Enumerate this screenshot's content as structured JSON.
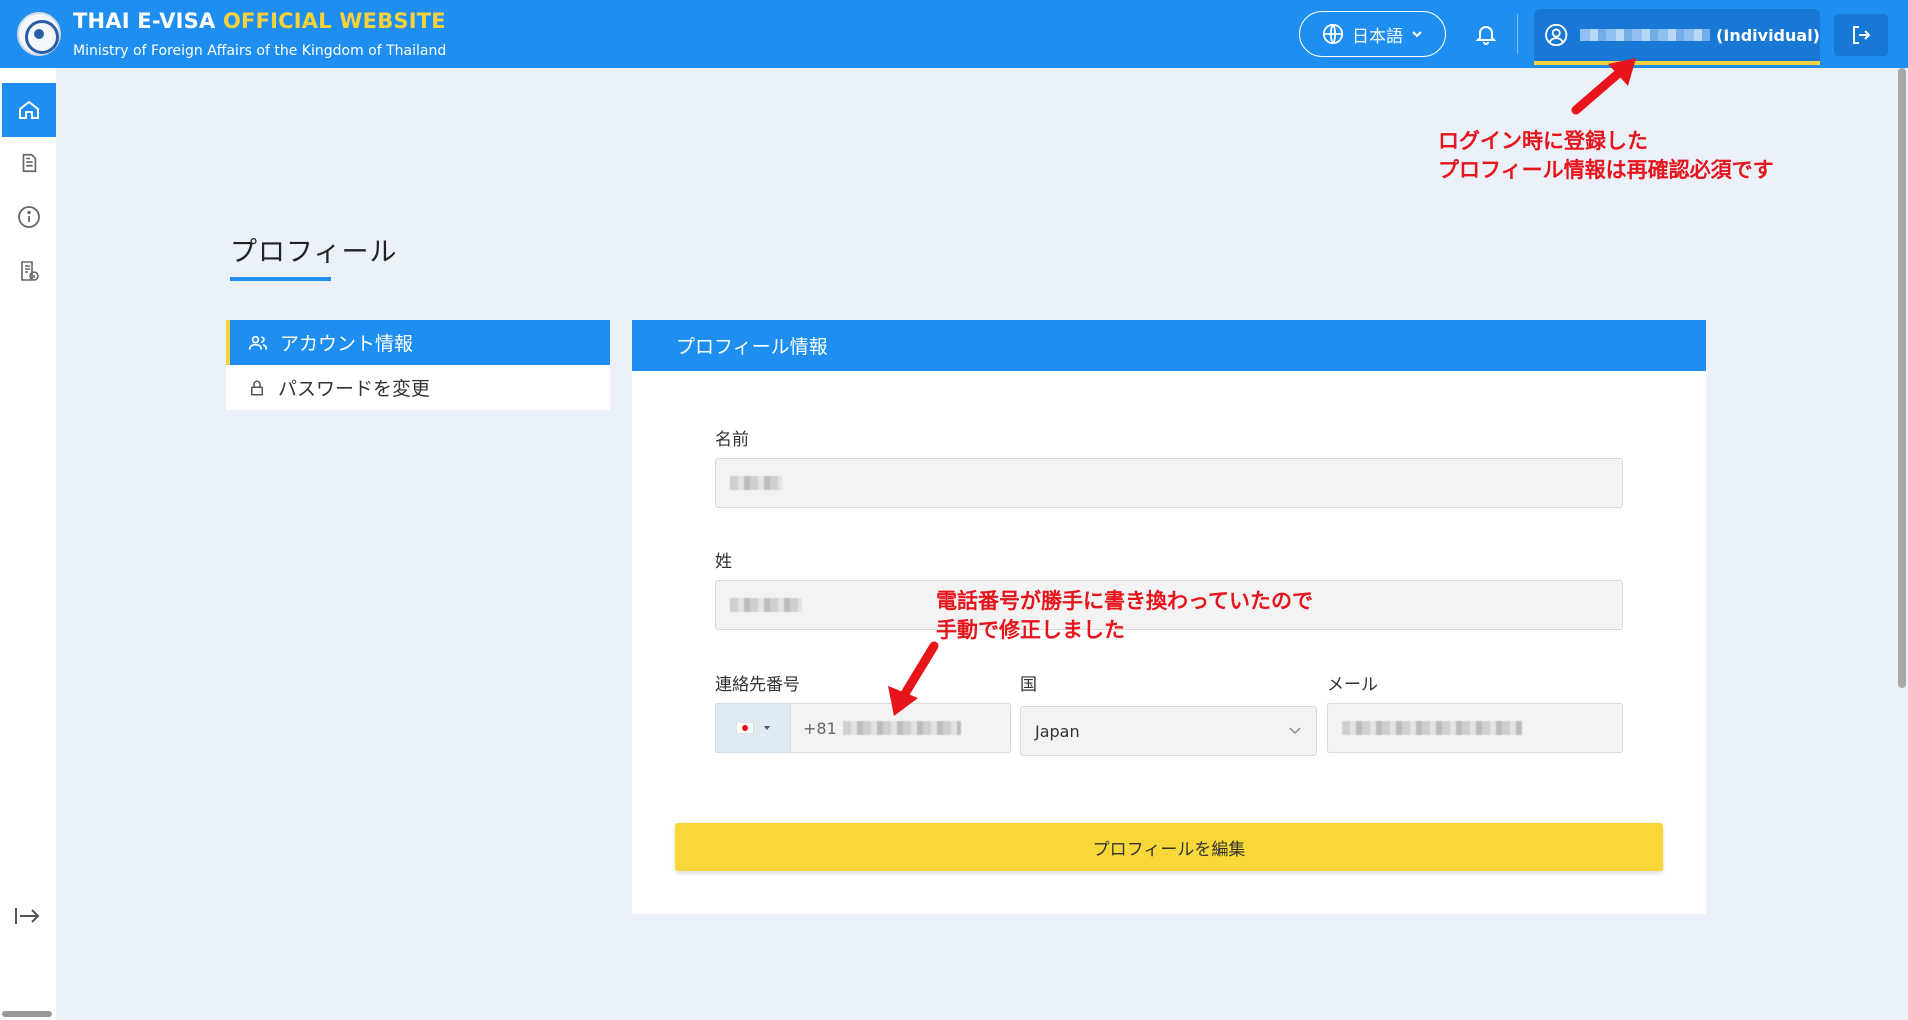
{
  "header": {
    "title_main": "THAI E-VISA ",
    "title_highlight": "OFFICIAL WEBSITE",
    "subtitle": "Ministry of Foreign Affairs of the Kingdom of Thailand",
    "language": "日本語",
    "user_role": "(Individual)"
  },
  "sidebar": {
    "items": [
      "home-icon",
      "document-icon",
      "info-icon",
      "guide-icon"
    ]
  },
  "page": {
    "title": "プロフィール"
  },
  "menu": {
    "items": [
      {
        "label": "アカウント情報",
        "active": true
      },
      {
        "label": "パスワードを変更",
        "active": false
      }
    ]
  },
  "card": {
    "title": "プロフィール情報",
    "first_name_label": "名前",
    "last_name_label": "姓",
    "phone_label": "連絡先番号",
    "phone_prefix": "+81",
    "country_label": "国",
    "country_value": "Japan",
    "email_label": "メール",
    "edit_button": "プロフィールを編集"
  },
  "annotations": {
    "top_line1": "ログイン時に登録した",
    "top_line2": "プロフィール情報は再確認必須です",
    "phone_line1": "電話番号が勝手に書き換わっていたので",
    "phone_line2": "手動で修正しました"
  },
  "colors": {
    "primary": "#1e8ff0",
    "accent": "#f8d838",
    "annotation": "#e8141c",
    "background": "#eaf1f8"
  }
}
